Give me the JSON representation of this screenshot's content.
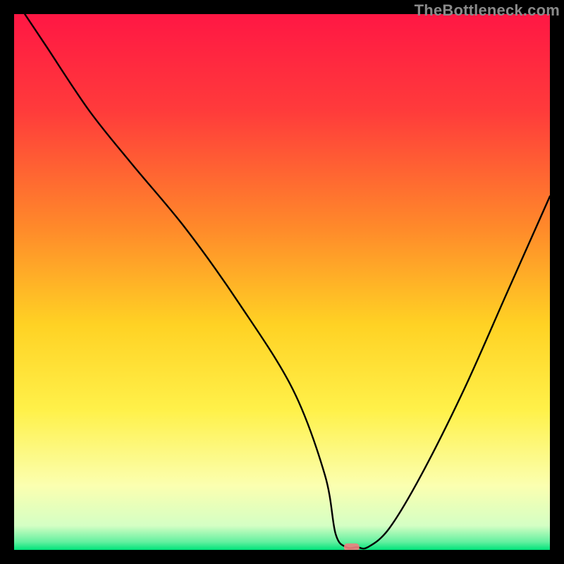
{
  "watermark": "TheBottleneck.com",
  "chart_data": {
    "type": "line",
    "title": "",
    "xlabel": "",
    "ylabel": "",
    "xlim": [
      0,
      100
    ],
    "ylim": [
      0,
      100
    ],
    "series": [
      {
        "name": "bottleneck-curve",
        "x": [
          2,
          6,
          14,
          22,
          32,
          42,
          52,
          58,
          60,
          62,
          64,
          66,
          70,
          76,
          84,
          92,
          100
        ],
        "values": [
          100,
          94,
          82,
          72,
          60,
          46,
          30,
          14,
          3,
          0.5,
          0.5,
          0.5,
          4,
          14,
          30,
          48,
          66
        ]
      }
    ],
    "optimum_marker": {
      "x": 63,
      "y": 0.5,
      "color": "#f08080"
    },
    "gradient_stops": [
      {
        "offset": 0,
        "color": "#ff1744"
      },
      {
        "offset": 0.18,
        "color": "#ff3b3b"
      },
      {
        "offset": 0.4,
        "color": "#ff8a2a"
      },
      {
        "offset": 0.58,
        "color": "#ffd224"
      },
      {
        "offset": 0.74,
        "color": "#fff14a"
      },
      {
        "offset": 0.88,
        "color": "#fbffb0"
      },
      {
        "offset": 0.955,
        "color": "#d4ffc4"
      },
      {
        "offset": 0.985,
        "color": "#64f0a0"
      },
      {
        "offset": 1.0,
        "color": "#00e37a"
      }
    ]
  }
}
